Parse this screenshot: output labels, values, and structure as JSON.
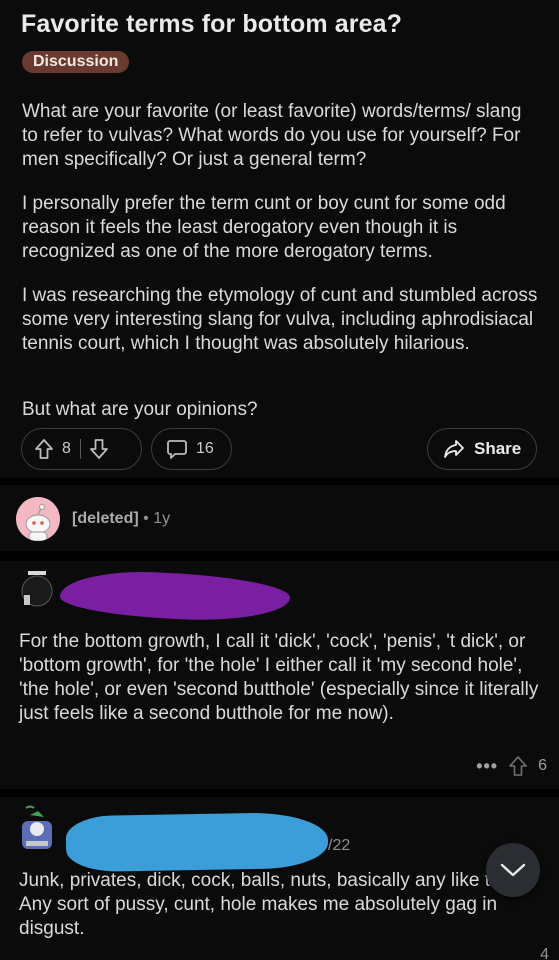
{
  "post": {
    "title": "Favorite terms for bottom area?",
    "flair": "Discussion",
    "paragraphs": [
      "What are your favorite (or least favorite) words/terms/ slang to refer to vulvas? What words do you use for yourself? For men specifically? Or just a general term?",
      "I personally prefer the term cunt or boy cunt for some odd reason it feels the least derogatory even though it is recognized as one of the more derogatory terms.",
      "I was researching the etymology of cunt and stumbled across some very interesting slang for vulva, including aphrodisiacal tennis court, which I thought was absolutely hilarious.",
      "But what are your opinions?"
    ],
    "vote_count": "8",
    "comment_count": "16",
    "share_label": "Share"
  },
  "deleted_comment": {
    "author": "[deleted]",
    "separator": "•",
    "age": "1y"
  },
  "comments": [
    {
      "text": "For the bottom growth, I call it 'dick', 'cock', 'penis', 't dick', or 'bottom growth', for 'the hole' I either call it 'my second hole', 'the hole', or even 'second butthole' (especially since it literally just feels like a second butthole for me now).",
      "more": "•••",
      "votes": "6"
    },
    {
      "date_tail": "/22",
      "text": "Junk, privates, dick, cock, balls, nuts, basically any like that. Any sort of pussy, cunt, hole makes me absolutely gag in disgust.",
      "votes": "4"
    }
  ],
  "icons": {
    "upvote": "arrow-up-icon",
    "downvote": "arrow-down-icon",
    "comment": "speech-bubble-icon",
    "share": "share-arrow-icon",
    "collapse": "chevron-down-icon"
  },
  "colors": {
    "flair_bg": "#6b3a2f",
    "redaction_purple": "#7b1fa2",
    "redaction_blue": "#3b9ed9",
    "avatar_pink": "#f4b8c3"
  }
}
